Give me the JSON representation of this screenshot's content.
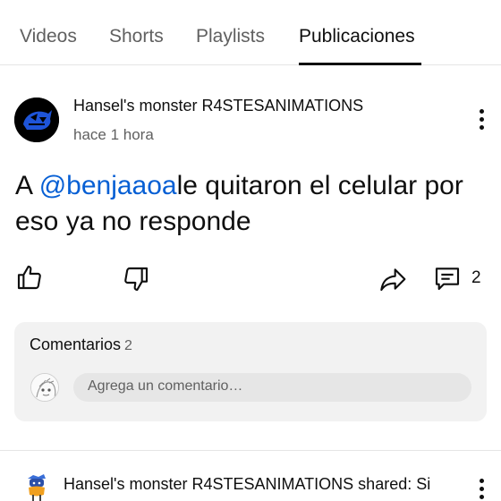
{
  "tabs": [
    {
      "label": "Videos"
    },
    {
      "label": "Shorts"
    },
    {
      "label": "Playlists"
    },
    {
      "label": "Publicaciones"
    }
  ],
  "post": {
    "author": "Hansel's monster R4STESANIMATIONS",
    "time": "hace 1 hora",
    "text_prefix": "A ",
    "mention": "@benjaaoa",
    "text_suffix": "le quitaron el celular por eso ya no responde",
    "comment_count": "2"
  },
  "comments": {
    "title": "Comentarios",
    "count": "2",
    "placeholder": "Agrega un comentario…"
  },
  "next_post": {
    "text": "Hansel's monster R4STESANIMATIONS shared: Si"
  },
  "colors": {
    "mention": "#065fd4",
    "avatar_accent": "#1e54d8"
  },
  "icons": [
    "like-icon",
    "dislike-icon",
    "share-icon",
    "comment-icon",
    "more-vert-icon"
  ]
}
